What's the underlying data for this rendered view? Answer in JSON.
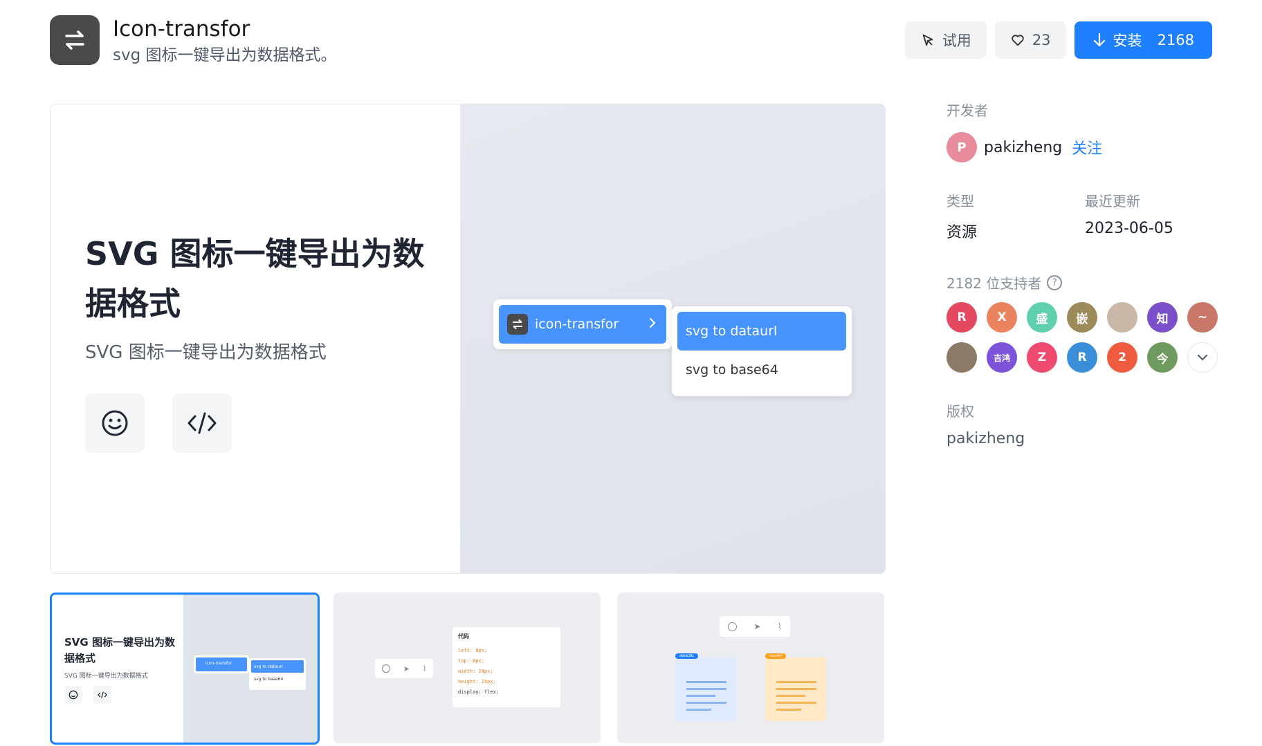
{
  "app": {
    "title": "Icon-transfor",
    "subtitle": "svg 图标一键导出为数据格式。",
    "icon": "swap-arrows-icon"
  },
  "actions": {
    "try_label": "试用",
    "likes": "23",
    "install_label": "安装",
    "install_count": "2168"
  },
  "preview": {
    "hero_title": "SVG 图标一键导出为数据格式",
    "hero_sub": "SVG 图标一键导出为数据格式",
    "menu_item": "icon-transfor",
    "submenu": [
      "svg to dataurl",
      "svg to base64"
    ],
    "icons": [
      "smile-icon",
      "code-icon"
    ]
  },
  "thumbnails": {
    "t1_title": "SVG 图标一键导出为数据格式",
    "t1_sub": "SVG 图标一键导出为数据格式",
    "t1_menu": "icon-transfor",
    "t1_sub1": "svg to dataurl",
    "t1_sub2": "svg to base64",
    "t2_code_title": "代码",
    "t2_code_lines": [
      "left: 8px;",
      "top: 8px;",
      "width: 24px;",
      "height: 24px;",
      "display: flex;"
    ],
    "t3_tag1": "dataURL",
    "t3_tag2": "base64"
  },
  "sidebar": {
    "developer_label": "开发者",
    "developer_initial": "P",
    "developer_name": "pakizheng",
    "follow_label": "关注",
    "type_label": "类型",
    "type_value": "资源",
    "updated_label": "最近更新",
    "updated_value": "2023-06-05",
    "supporters_label": "2182 位支持者",
    "help_icon": "question-icon",
    "copyright_label": "版权",
    "copyright_value": "pakizheng"
  },
  "supporters": [
    {
      "text": "R",
      "color": "#e5495f"
    },
    {
      "text": "X",
      "color": "#e9845f"
    },
    {
      "text": "盛",
      "color": "#5fcfae"
    },
    {
      "text": "嵌",
      "color": "#9c8a5a"
    },
    {
      "text": "",
      "color": "#c9b7a8",
      "icon": "cartoon-avatar"
    },
    {
      "text": "知",
      "color": "#7b4fc9"
    },
    {
      "text": "~",
      "color": "#c97768"
    },
    {
      "text": "",
      "color": "#8a7a66",
      "icon": "pug-avatar"
    },
    {
      "text": "吉鸿",
      "color": "#7c53d9"
    },
    {
      "text": "Z",
      "color": "#ef4b70"
    },
    {
      "text": "R",
      "color": "#3b8fd9"
    },
    {
      "text": "2",
      "color": "#ef5b3f"
    },
    {
      "text": "今",
      "color": "#6f9a5f"
    }
  ]
}
